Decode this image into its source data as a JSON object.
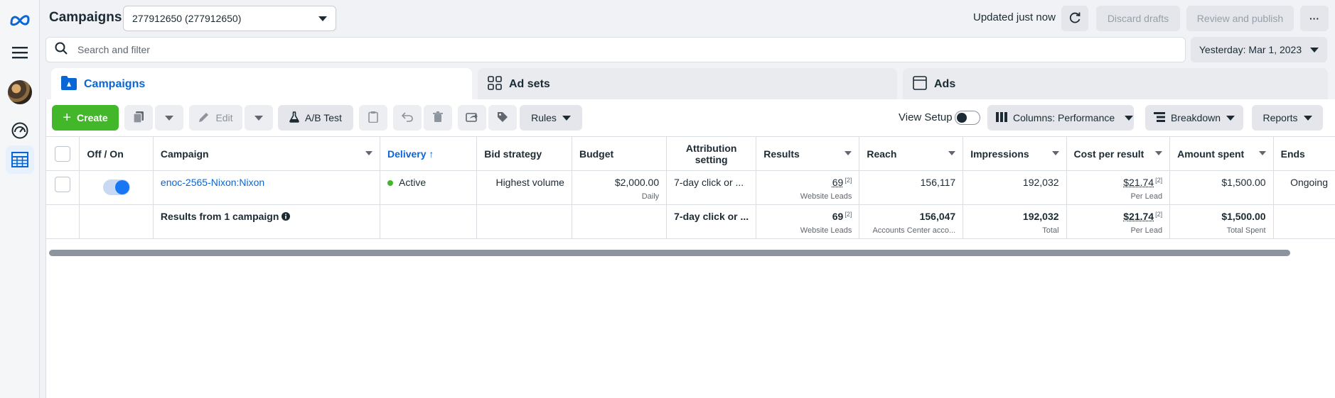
{
  "app": {
    "title": "Campaigns",
    "account": "277912650 (277912650)",
    "updated": "Updated just now",
    "discard_label": "Discard drafts",
    "review_label": "Review and publish",
    "more_label": "···"
  },
  "search": {
    "placeholder": "Search and filter"
  },
  "date_range": "Yesterday: Mar 1, 2023",
  "tabs": [
    {
      "label": "Campaigns",
      "icon": "campaign-folder-icon"
    },
    {
      "label": "Ad sets",
      "icon": "grid-icon"
    },
    {
      "label": "Ads",
      "icon": "ad-window-icon"
    }
  ],
  "toolbar": {
    "create": "Create",
    "edit": "Edit",
    "ab_test": "A/B Test",
    "rules": "Rules",
    "view_setup": "View Setup",
    "columns": "Columns: Performance",
    "breakdown": "Breakdown",
    "reports": "Reports"
  },
  "table": {
    "headers": {
      "off_on": "Off / On",
      "campaign": "Campaign",
      "delivery": "Delivery ↑",
      "bid_strategy": "Bid strategy",
      "budget": "Budget",
      "attribution": "Attribution setting",
      "results": "Results",
      "reach": "Reach",
      "impressions": "Impressions",
      "cost_per_result": "Cost per result",
      "amount_spent": "Amount spent",
      "ends": "Ends"
    },
    "row": {
      "campaign": "enoc-2565-Nixon:Nixon",
      "delivery": "Active",
      "bid_strategy": "Highest volume",
      "budget": "$2,000.00",
      "budget_sub": "Daily",
      "attribution": "7-day click or ...",
      "results": "69",
      "results_sup": "[2]",
      "results_sub": "Website Leads",
      "reach": "156,117",
      "impressions": "192,032",
      "cost": "$21.74",
      "cost_sup": "[2]",
      "cost_sub": "Per Lead",
      "spent": "$1,500.00",
      "ends": "Ongoing"
    },
    "summary": {
      "label": "Results from 1 campaign",
      "attribution": "7-day click or ...",
      "results": "69",
      "results_sup": "[2]",
      "results_sub": "Website Leads",
      "reach": "156,047",
      "reach_sub": "Accounts Center acco...",
      "impressions": "192,032",
      "impressions_sub": "Total",
      "cost": "$21.74",
      "cost_sup": "[2]",
      "cost_sub": "Per Lead",
      "spent": "$1,500.00",
      "spent_sub": "Total Spent"
    }
  },
  "colors": {
    "accent": "#0a66d4",
    "create_green": "#42b72a",
    "active_dot": "#42b72a"
  }
}
